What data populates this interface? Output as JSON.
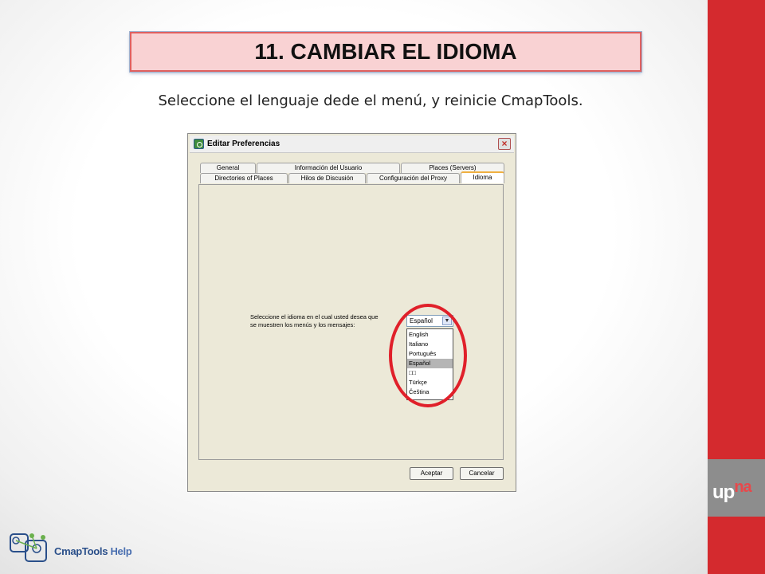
{
  "slide": {
    "title": "11. CAMBIAR EL IDIOMA",
    "subtitle": "Seleccione el lenguaje dede el menú, y reinicie CmapTools."
  },
  "dialog": {
    "title": "Editar Preferencias",
    "close_icon": "×",
    "tabs_row1": [
      "General",
      "Información del Usuario",
      "Places (Servers)"
    ],
    "tabs_row2": [
      "Directories of Places",
      "Hilos de Discusión",
      "Configuración del Proxy",
      "Idioma"
    ],
    "active_tab": "Idioma",
    "language_prompt_line1": "Seleccione el idioma en el cual usted desea que",
    "language_prompt_line2": "se muestren los menús y los mensajes:",
    "language_select": {
      "value": "Español",
      "options": [
        "English",
        "Italiano",
        "Português",
        "Español",
        "□□",
        "Türkçe",
        "Čeština"
      ],
      "selected_index": 3
    },
    "buttons": {
      "accept": "Aceptar",
      "cancel": "Cancelar"
    }
  },
  "branding": {
    "upna": "up",
    "upna_accent": "na",
    "cmaptools_name": "CmapTools",
    "cmaptools_help": "Help"
  },
  "colors": {
    "sidebar": "#d42a2e",
    "title_fill": "#f9d2d3",
    "highlight_ring": "#e0202a"
  },
  "icons": [
    "app-icon",
    "close-icon",
    "chevron-down-icon",
    "upna-logo",
    "cmaptools-logo"
  ]
}
